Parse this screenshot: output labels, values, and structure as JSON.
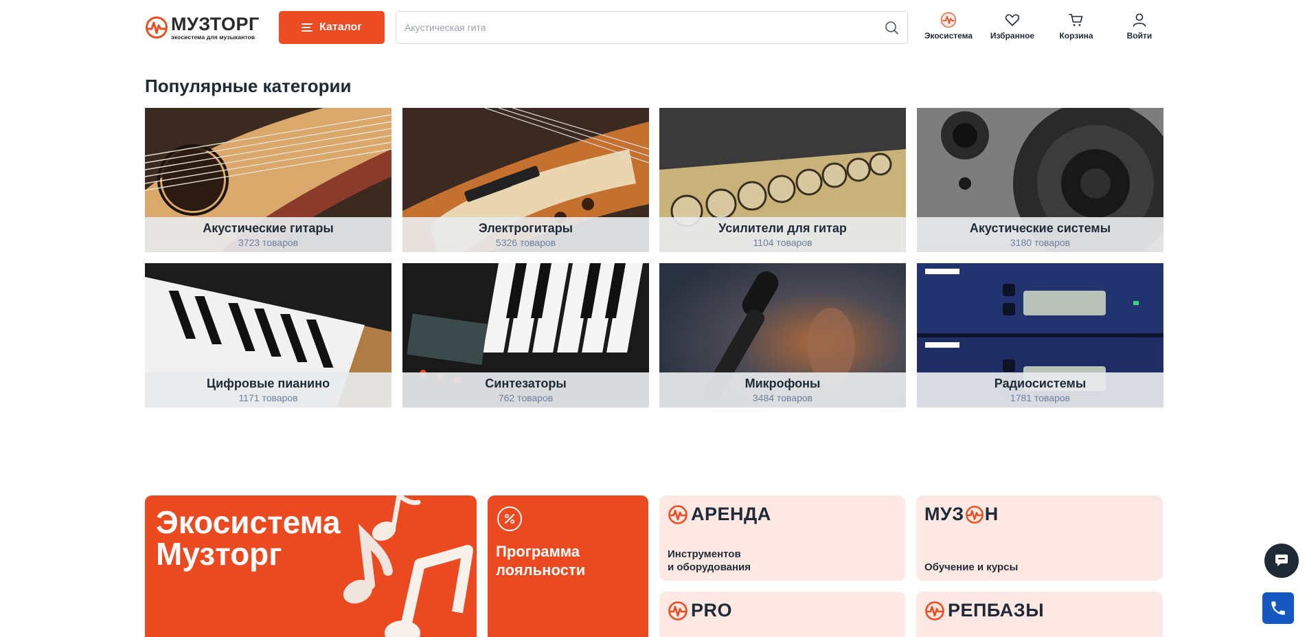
{
  "header": {
    "logo_name": "МУЗТОРГ",
    "logo_tagline": "экосистема для музыкантов",
    "catalog_label": "Каталог",
    "search_placeholder": "Акустическая гита",
    "nav": [
      {
        "label": "Экосистема",
        "icon": "ecosystem-icon"
      },
      {
        "label": "Избранное",
        "icon": "heart-icon"
      },
      {
        "label": "Корзина",
        "icon": "cart-icon"
      },
      {
        "label": "Войти",
        "icon": "user-icon"
      }
    ]
  },
  "categories": {
    "title": "Популярные категории",
    "items": [
      {
        "name": "Акустические гитары",
        "count": "3723 товаров"
      },
      {
        "name": "Электрогитары",
        "count": "5326 товаров"
      },
      {
        "name": "Усилители для гитар",
        "count": "1104 товаров"
      },
      {
        "name": "Акустические системы",
        "count": "3180 товаров"
      },
      {
        "name": "Цифровые пианино",
        "count": "1171 товаров"
      },
      {
        "name": "Синтезаторы",
        "count": "762 товаров"
      },
      {
        "name": "Микрофоны",
        "count": "3484 товаров"
      },
      {
        "name": "Радиосистемы",
        "count": "1781 товаров"
      }
    ]
  },
  "ecosystem": {
    "title_line1": "Экосистема",
    "title_line2": "Музторг",
    "loyalty_line1": "Программа",
    "loyalty_line2": "лояльности",
    "rent_brand": "АРЕНДА",
    "rent_desc_line1": "Инструментов",
    "rent_desc_line2": "и оборудования",
    "muzon_brand_left": "МУЗ",
    "muzon_brand_right": "Н",
    "muzon_desc": "Обучение и курсы",
    "pro_brand": "PRO",
    "repbase_brand": "РЕПБАЗЫ"
  },
  "colors": {
    "brand_orange": "#eb4c22",
    "text_dark": "#1f2a37",
    "count_blue": "#6c7fa0",
    "pink_bg": "#fde8e3",
    "phone_blue": "#1558c0"
  }
}
